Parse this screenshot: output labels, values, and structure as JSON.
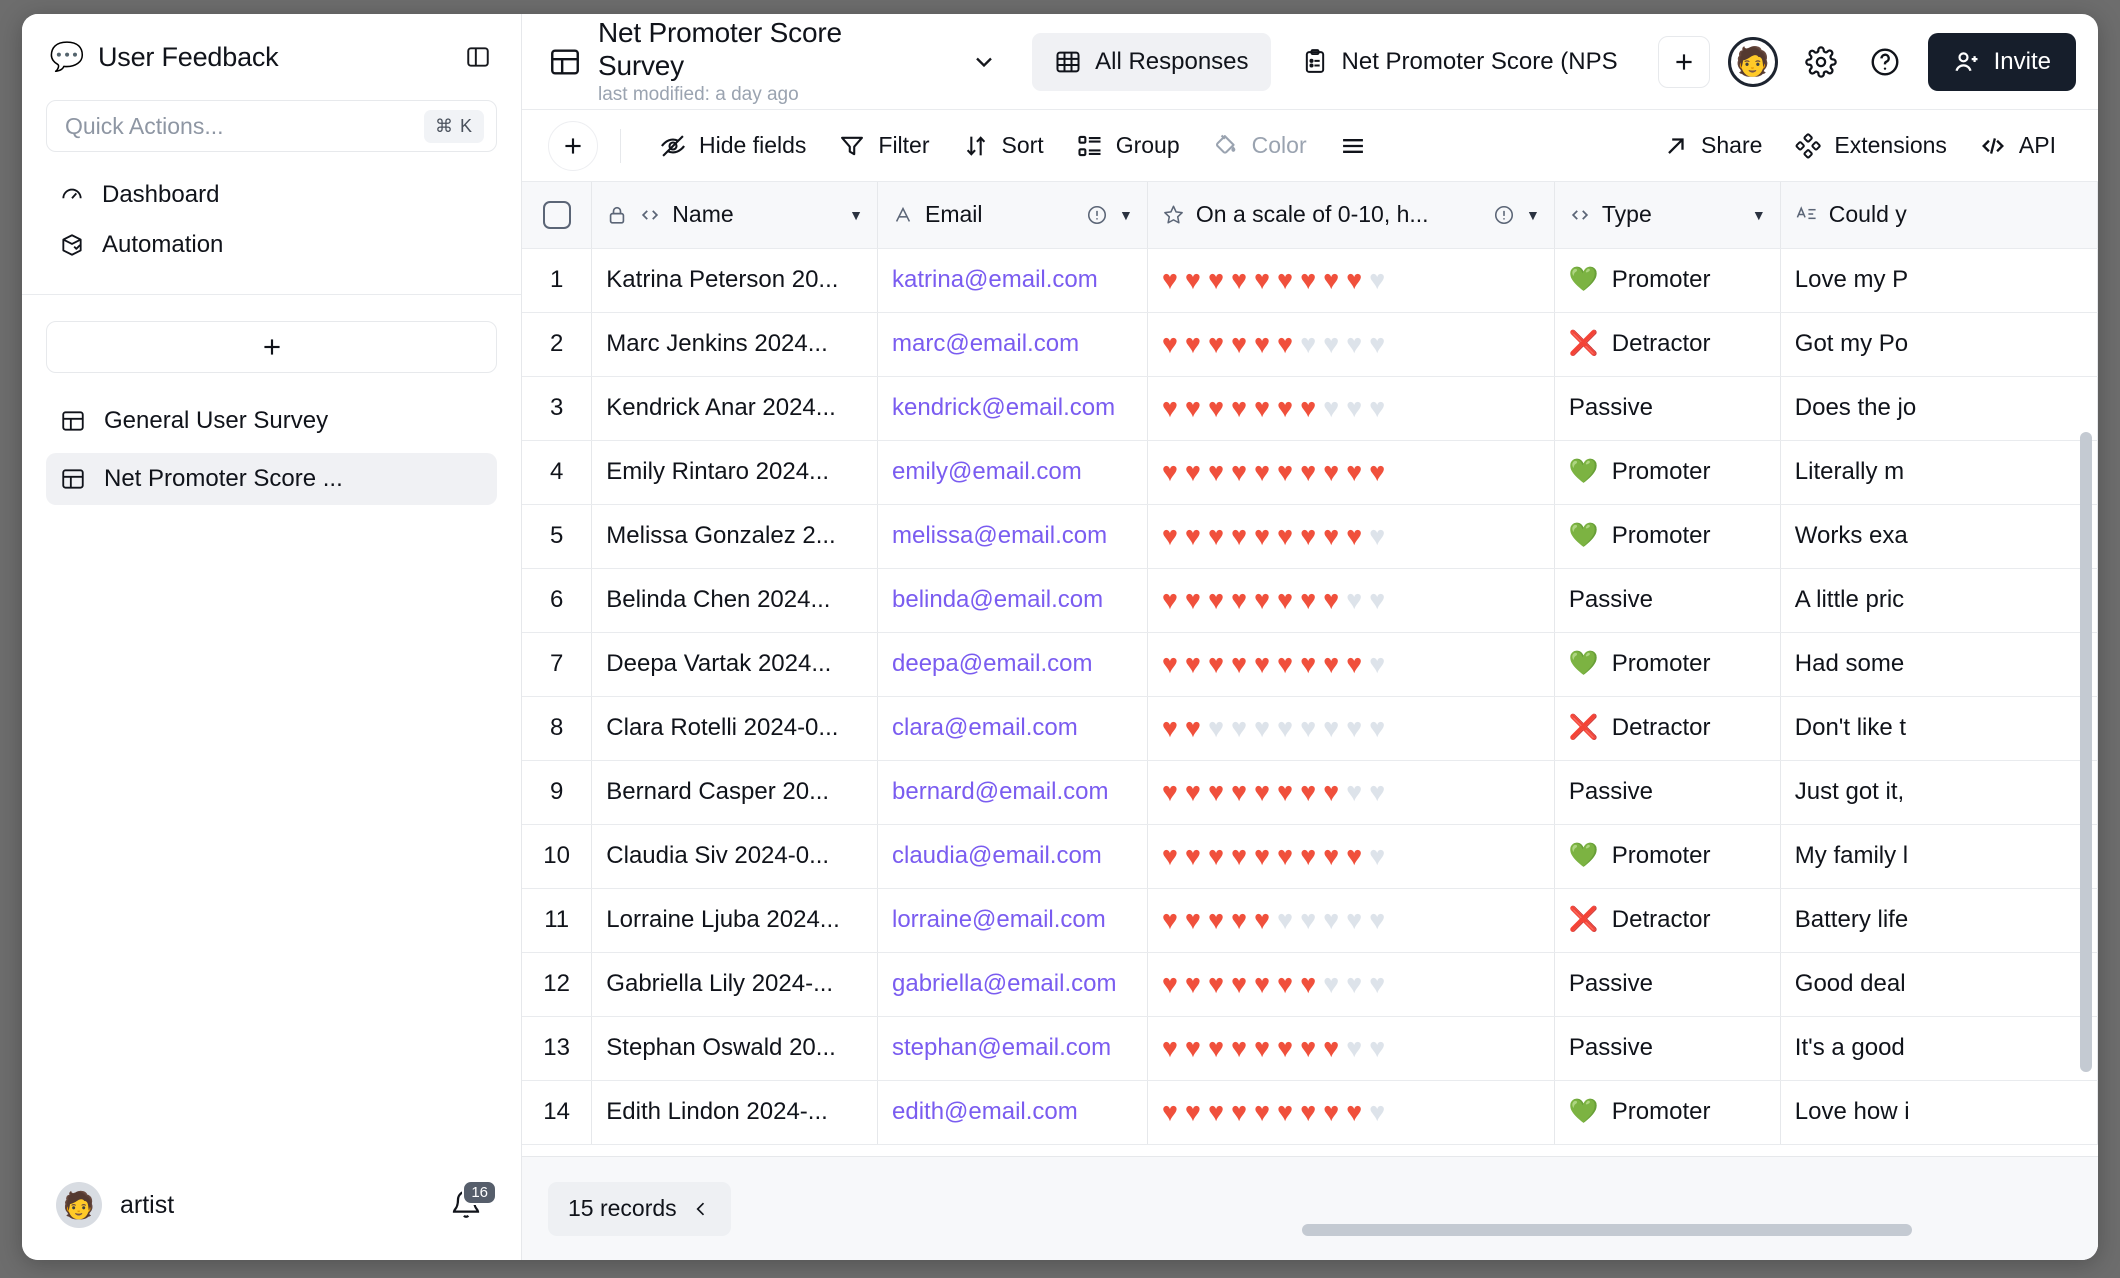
{
  "sidebar": {
    "workspace_emoji": "💬",
    "workspace_title": "User Feedback",
    "panel_toggle_icon": "panel-collapse-icon",
    "search": {
      "placeholder": "Quick Actions...",
      "value": "",
      "shortcut": "⌘ K"
    },
    "nav": [
      {
        "label": "Dashboard",
        "icon": "gauge-icon"
      },
      {
        "label": "Automation",
        "icon": "package-check-icon"
      }
    ],
    "add_button_label": "+",
    "tables": [
      {
        "label": "General User Survey",
        "icon": "table-icon",
        "active": false
      },
      {
        "label": "Net Promoter Score ...",
        "icon": "table-icon",
        "active": true
      }
    ],
    "account": {
      "name": "artist",
      "avatar_emoji": "🧑",
      "notification_count": "16"
    }
  },
  "topbar": {
    "table_icon": "table-icon",
    "table_name": "Net Promoter Score Survey",
    "last_modified": "last modified: a day ago",
    "chevron_icon": "chevron-down-icon",
    "views": [
      {
        "label": "All Responses",
        "icon": "grid-view-icon",
        "active": true
      },
      {
        "label": "Net Promoter Score (NPS",
        "icon": "form-icon",
        "active": false
      }
    ],
    "add_view_label": "+",
    "avatar_emoji": "🧑",
    "settings_icon": "gear-icon",
    "help_icon": "question-circle-icon",
    "invite_label": "Invite",
    "invite_icon": "user-plus-icon",
    "invite_color": "#161e2b"
  },
  "toolbar": {
    "add_label": "+",
    "items": [
      {
        "label": "Hide fields",
        "icon": "eye-off-icon",
        "muted": false
      },
      {
        "label": "Filter",
        "icon": "funnel-icon",
        "muted": false
      },
      {
        "label": "Sort",
        "icon": "sort-arrows-icon",
        "muted": false
      },
      {
        "label": "Group",
        "icon": "group-icon",
        "muted": false
      },
      {
        "label": "Color",
        "icon": "paint-bucket-icon",
        "muted": true
      },
      {
        "label": "",
        "icon": "row-height-icon",
        "muted": false
      }
    ],
    "right_items": [
      {
        "label": "Share",
        "icon": "share-arrow-icon"
      },
      {
        "label": "Extensions",
        "icon": "extensions-diamond-icon"
      },
      {
        "label": "API",
        "icon": "code-brackets-icon"
      }
    ]
  },
  "grid": {
    "columns": [
      {
        "key": "check",
        "label": "",
        "icon": "checkbox-icon",
        "caret": false,
        "warn": false
      },
      {
        "key": "name",
        "label": "Name",
        "icon": "code-brackets-icon",
        "lock": true,
        "caret": true,
        "warn": false
      },
      {
        "key": "email",
        "label": "Email",
        "icon": "letter-a-icon",
        "caret": true,
        "warn": true
      },
      {
        "key": "score",
        "label": "On a scale of 0-10, h...",
        "icon": "star-icon",
        "caret": true,
        "warn": true
      },
      {
        "key": "type",
        "label": "Type",
        "icon": "code-brackets-icon",
        "caret": true,
        "warn": false
      },
      {
        "key": "could",
        "label": "Could y",
        "icon": "long-text-icon",
        "caret": false,
        "warn": false
      }
    ],
    "rating_max": 10,
    "heart_on_color": "#f0503c",
    "heart_off_color": "#dde3ea",
    "rows": [
      {
        "num": "1",
        "name": "Katrina Peterson 20...",
        "email": "katrina@email.com",
        "score": 9,
        "type": "Promoter",
        "type_glyph": "💚",
        "could": "Love my P"
      },
      {
        "num": "2",
        "name": "Marc Jenkins 2024...",
        "email": "marc@email.com",
        "score": 6,
        "type": "Detractor",
        "type_glyph": "❌",
        "could": "Got my Po"
      },
      {
        "num": "3",
        "name": "Kendrick Anar 2024...",
        "email": "kendrick@email.com",
        "score": 7,
        "type": "Passive",
        "type_glyph": "",
        "could": "Does the jo"
      },
      {
        "num": "4",
        "name": "Emily Rintaro 2024...",
        "email": "emily@email.com",
        "score": 10,
        "type": "Promoter",
        "type_glyph": "💚",
        "could": "Literally m"
      },
      {
        "num": "5",
        "name": "Melissa Gonzalez 2...",
        "email": "melissa@email.com",
        "score": 9,
        "type": "Promoter",
        "type_glyph": "💚",
        "could": "Works exa"
      },
      {
        "num": "6",
        "name": "Belinda Chen 2024...",
        "email": "belinda@email.com",
        "score": 8,
        "type": "Passive",
        "type_glyph": "",
        "could": "A little pric"
      },
      {
        "num": "7",
        "name": "Deepa Vartak 2024...",
        "email": "deepa@email.com",
        "score": 9,
        "type": "Promoter",
        "type_glyph": "💚",
        "could": "Had some"
      },
      {
        "num": "8",
        "name": "Clara Rotelli 2024-0...",
        "email": "clara@email.com",
        "score": 2,
        "type": "Detractor",
        "type_glyph": "❌",
        "could": "Don't like t"
      },
      {
        "num": "9",
        "name": "Bernard Casper 20...",
        "email": "bernard@email.com",
        "score": 8,
        "type": "Passive",
        "type_glyph": "",
        "could": "Just got it,"
      },
      {
        "num": "10",
        "name": "Claudia Siv 2024-0...",
        "email": "claudia@email.com",
        "score": 9,
        "type": "Promoter",
        "type_glyph": "💚",
        "could": "My family l"
      },
      {
        "num": "11",
        "name": "Lorraine Ljuba 2024...",
        "email": "lorraine@email.com",
        "score": 5,
        "type": "Detractor",
        "type_glyph": "❌",
        "could": "Battery life"
      },
      {
        "num": "12",
        "name": "Gabriella Lily 2024-...",
        "email": "gabriella@email.com",
        "score": 7,
        "type": "Passive",
        "type_glyph": "",
        "could": "Good deal"
      },
      {
        "num": "13",
        "name": "Stephan Oswald 20...",
        "email": "stephan@email.com",
        "score": 8,
        "type": "Passive",
        "type_glyph": "",
        "could": "It's a good"
      },
      {
        "num": "14",
        "name": "Edith Lindon 2024-...",
        "email": "edith@email.com",
        "score": 9,
        "type": "Promoter",
        "type_glyph": "💚",
        "could": "Love how i"
      }
    ]
  },
  "footer": {
    "records_label": "15 records",
    "collapse_icon": "chevron-left-icon"
  }
}
